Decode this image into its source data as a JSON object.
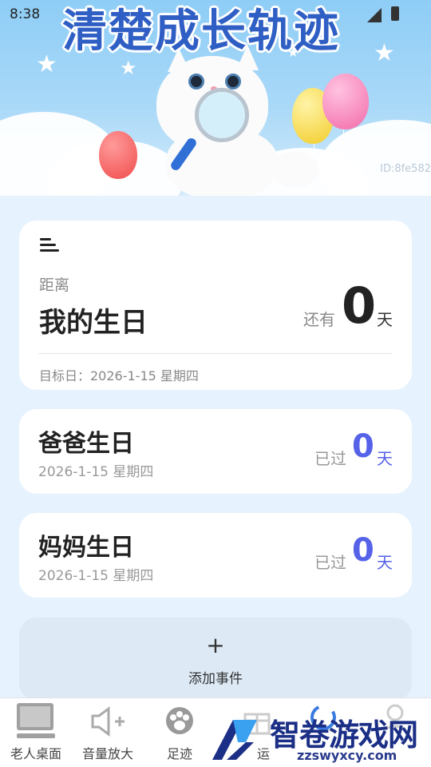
{
  "status_bar": {
    "time": "8:38"
  },
  "hero": {
    "title": "清楚成长轨迹",
    "id_text": "ID:8fe582"
  },
  "main_card": {
    "distance_label": "距离",
    "title": "我的生日",
    "remain_label": "还有",
    "count": "0",
    "unit": "天",
    "target_date": "目标日：2026-1-15 星期四"
  },
  "events": [
    {
      "title": "爸爸生日",
      "date": "2026-1-15 星期四",
      "status": "已过",
      "count": "0",
      "unit": "天"
    },
    {
      "title": "妈妈生日",
      "date": "2026-1-15 星期四",
      "status": "已过",
      "count": "0",
      "unit": "天"
    }
  ],
  "add_event": {
    "icon": "plus-icon",
    "label": "添加事件"
  },
  "nav": {
    "items": [
      {
        "label": "老人桌面",
        "icon": "monitor-icon"
      },
      {
        "label": "音量放大",
        "icon": "speaker-plus-icon"
      },
      {
        "label": "足迹",
        "icon": "paw-icon"
      },
      {
        "label": "运",
        "icon": "gift-icon"
      },
      {
        "label": "",
        "icon": "sync-icon"
      },
      {
        "label": "",
        "icon": "person-icon"
      }
    ]
  },
  "watermark": {
    "text": "智卷游戏网",
    "url": "zzswyxcy.com"
  },
  "colors": {
    "accent": "#5662e8",
    "background": "#e6f2fd",
    "hero_title": "#2f5fc4"
  }
}
